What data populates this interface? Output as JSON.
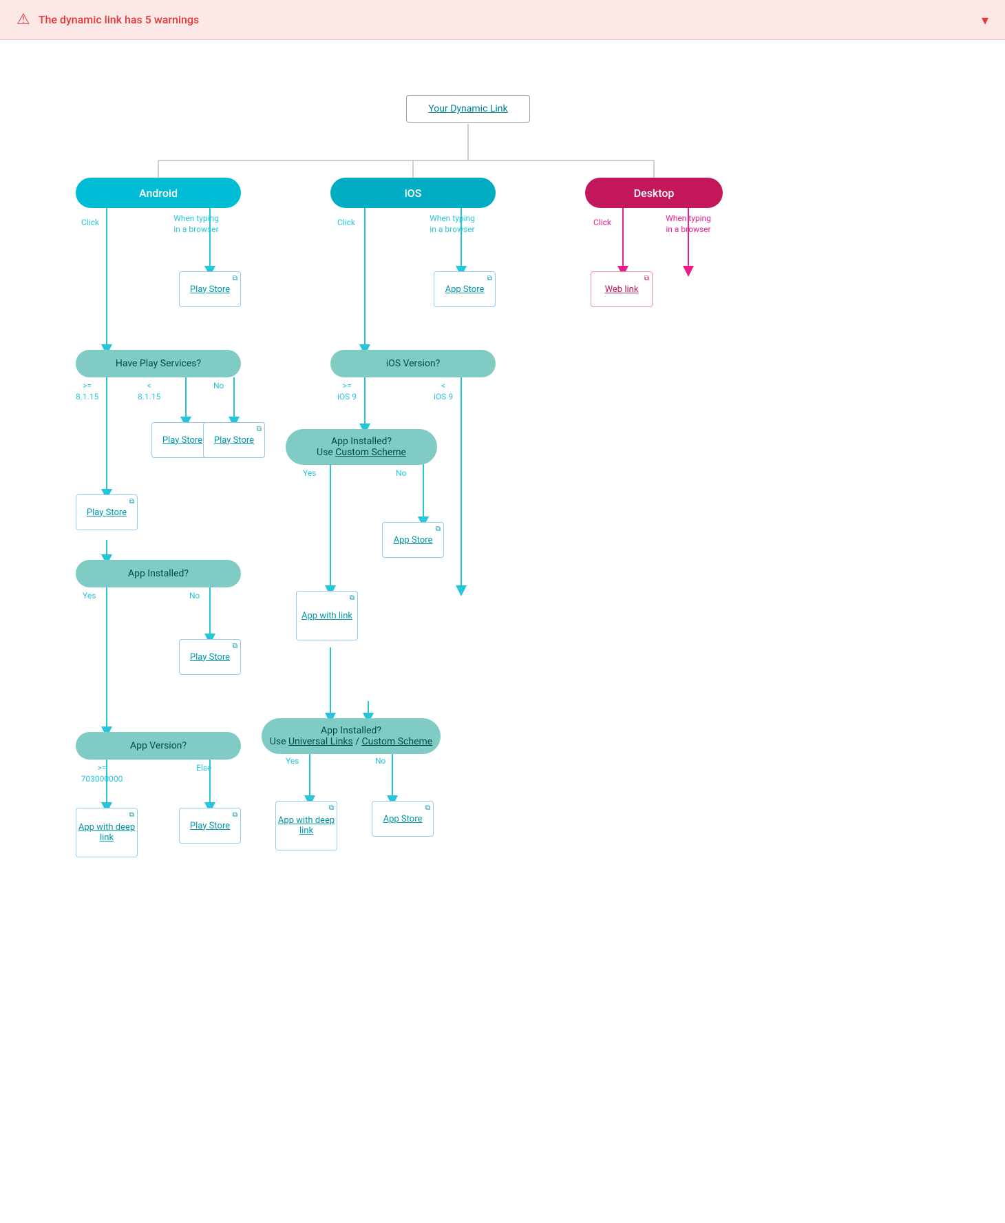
{
  "banner": {
    "text": "The dynamic link has 5 warnings",
    "chevron": "▾"
  },
  "nodes": {
    "dynamicLink": {
      "label": "Your Dynamic Link"
    },
    "android": {
      "label": "Android"
    },
    "ios": {
      "label": "iOS"
    },
    "desktop": {
      "label": "Desktop"
    },
    "playServicesQ": {
      "label": "Have Play Services?"
    },
    "iosVersionQ": {
      "label": "iOS Version?"
    },
    "appInstalledAndroid": {
      "label": "App Installed?"
    },
    "appInstalledIosCustom": {
      "label": "App Installed? Use Custom Scheme"
    },
    "appInstalledIosUniversal": {
      "label": "App Installed? Use Universal Links / Custom Scheme"
    },
    "appVersionQ": {
      "label": "App Version?"
    },
    "playStore1": {
      "label": "Play Store"
    },
    "playStore2": {
      "label": "Play Store"
    },
    "playStore3": {
      "label": "Play Store"
    },
    "playStore4": {
      "label": "Play Store"
    },
    "playStore5": {
      "label": "Play Store"
    },
    "playStore6": {
      "label": "Play Store"
    },
    "appStore1": {
      "label": "App Store"
    },
    "appStore2": {
      "label": "App Store"
    },
    "appStore3": {
      "label": "App Store"
    },
    "webLink": {
      "label": "Web link"
    },
    "appDeepLink1": {
      "label": "App with deep link"
    },
    "appDeepLink2": {
      "label": "App with deep link"
    },
    "appDeepLink3": {
      "label": "App with deep link"
    },
    "appWithLink": {
      "label": "App with link"
    }
  },
  "labels": {
    "click": "Click",
    "whenTyping": "When typing\nin a browser",
    "geq815": ">= 8.1.15",
    "lt815": "< 8.1.15",
    "no": "No",
    "yes": "Yes",
    "geqIos9": ">= iOS 9",
    "ltIos9": "< iOS 9",
    "geq703": ">= 703000000",
    "else": "Else"
  }
}
